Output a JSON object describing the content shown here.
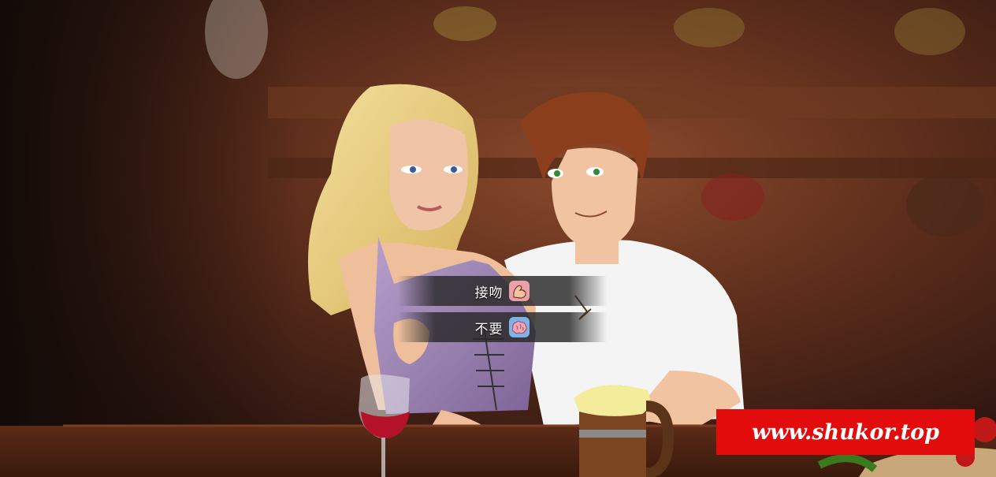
{
  "choices": [
    {
      "label": "接吻",
      "icon": "strength-arm-icon"
    },
    {
      "label": "不要",
      "icon": "brain-icon"
    }
  ],
  "watermark": {
    "text": "www.shukor.top"
  },
  "colors": {
    "choice_bg": "#282828",
    "watermark_bg": "#e30c0c",
    "text": "#ffffff"
  }
}
